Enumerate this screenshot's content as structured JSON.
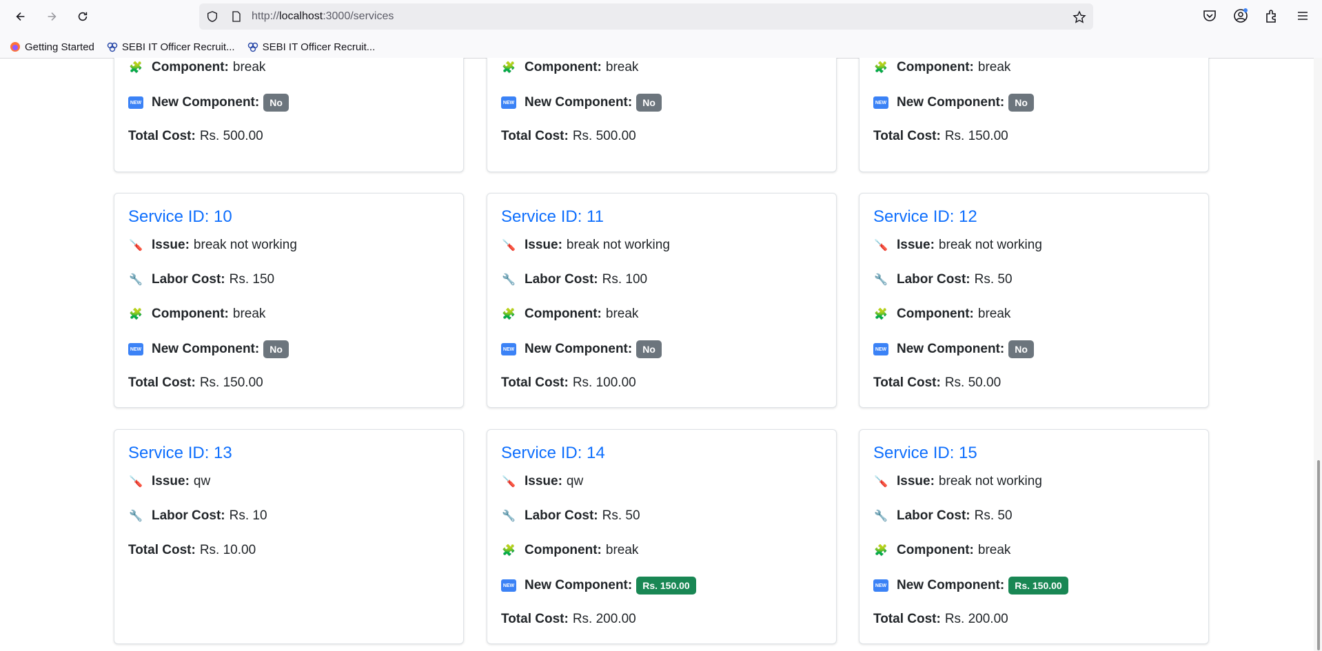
{
  "browser": {
    "url_prefix": "http://",
    "url_host": "localhost",
    "url_path": ":3000/services",
    "bookmarks": [
      {
        "label": "Getting Started"
      },
      {
        "label": "SEBI IT Officer Recruit..."
      },
      {
        "label": "SEBI IT Officer Recruit..."
      }
    ]
  },
  "labels": {
    "issue": "Issue:",
    "labor": "Labor Cost:",
    "component": "Component:",
    "new_component": "New Component:",
    "total": "Total Cost:"
  },
  "colors": {
    "link": "#0d6efd",
    "badge_no": "#6c757d",
    "badge_yes": "#198754"
  },
  "cards": [
    {
      "component": "break",
      "new_component": "No",
      "total": "Rs. 500.00"
    },
    {
      "component": "break",
      "new_component": "No",
      "total": "Rs. 500.00"
    },
    {
      "component": "break",
      "new_component": "No",
      "total": "Rs. 150.00"
    },
    {
      "title": "Service ID: 10",
      "issue": "break not working",
      "labor": "Rs. 150",
      "component": "break",
      "new_component": "No",
      "total": "Rs. 150.00"
    },
    {
      "title": "Service ID: 11",
      "issue": "break not working",
      "labor": "Rs. 100",
      "component": "break",
      "new_component": "No",
      "total": "Rs. 100.00"
    },
    {
      "title": "Service ID: 12",
      "issue": "break not working",
      "labor": "Rs. 50",
      "component": "break",
      "new_component": "No",
      "total": "Rs. 50.00"
    },
    {
      "title": "Service ID: 13",
      "issue": "qw",
      "labor": "Rs. 10",
      "total": "Rs. 10.00"
    },
    {
      "title": "Service ID: 14",
      "issue": "qw",
      "labor": "Rs. 50",
      "component": "break",
      "new_component": "Rs. 150.00",
      "total": "Rs. 200.00"
    },
    {
      "title": "Service ID: 15",
      "issue": "break not working",
      "labor": "Rs. 50",
      "component": "break",
      "new_component": "Rs. 150.00",
      "total": "Rs. 200.00"
    }
  ]
}
